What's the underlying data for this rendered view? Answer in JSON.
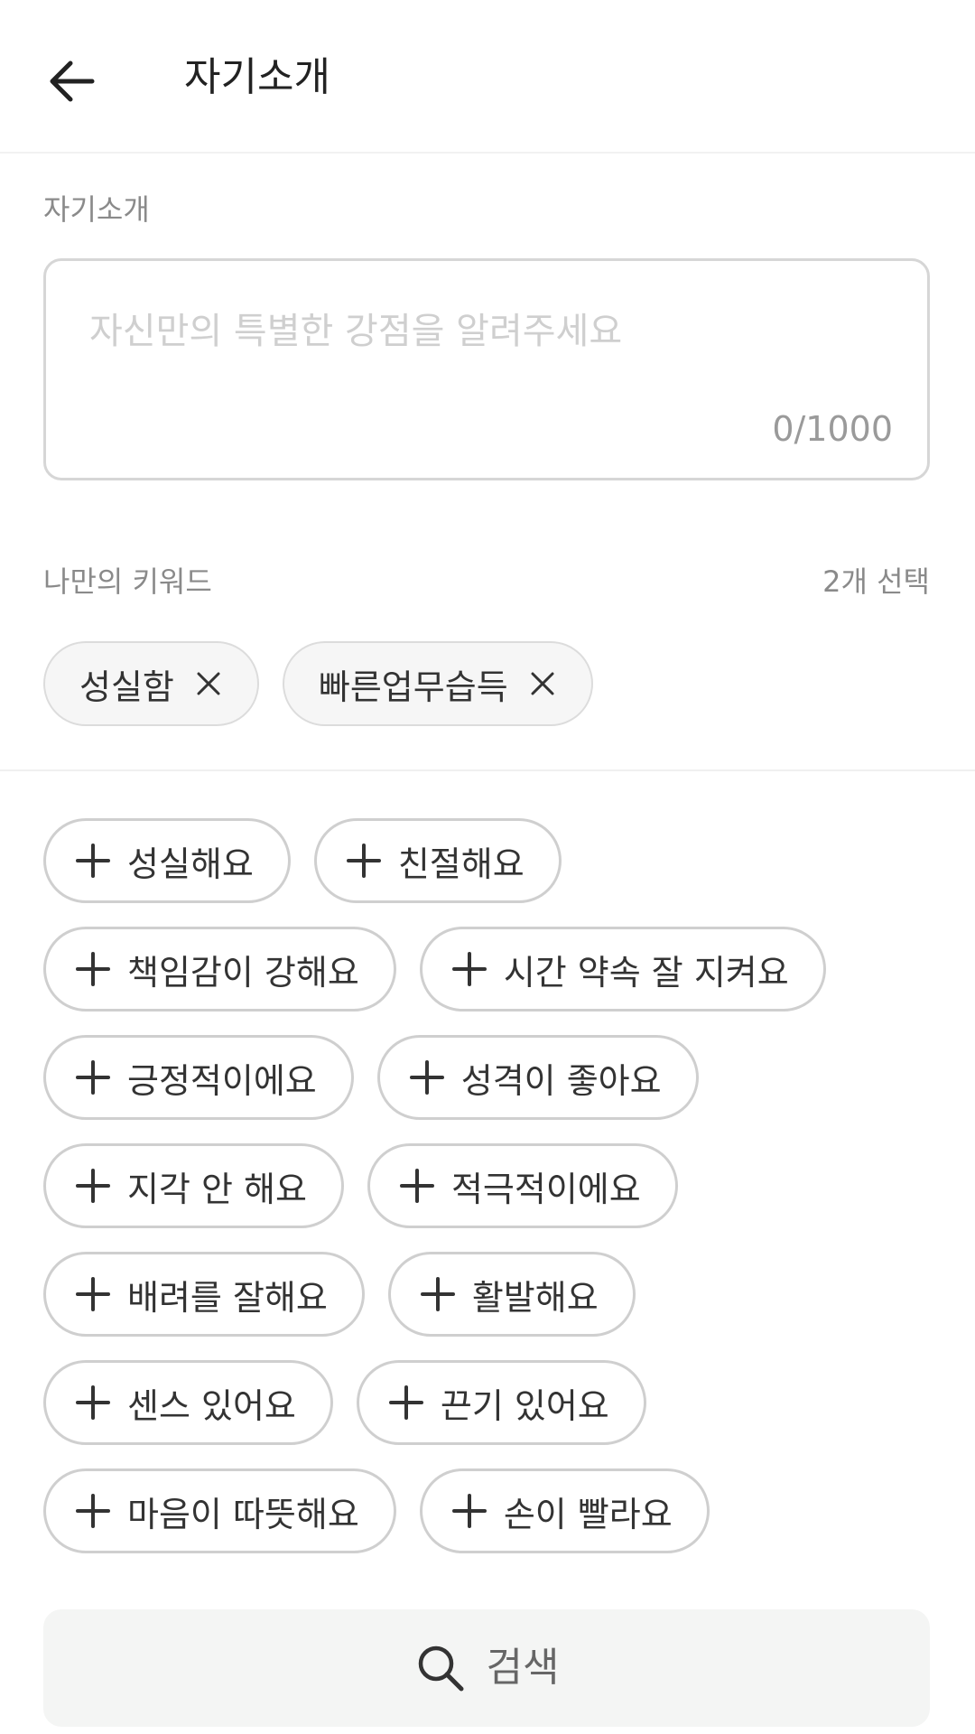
{
  "header": {
    "title": "자기소개",
    "back_icon": "arrow-left-icon"
  },
  "intro": {
    "label": "자기소개",
    "placeholder": "자신만의 특별한 강점을 알려주세요",
    "counter": "0/1000"
  },
  "keywords": {
    "label": "나만의 키워드",
    "selected_count": "2개 선택",
    "selected": [
      "성실함",
      "빠른업무습득"
    ],
    "options_rows": [
      [
        "성실해요",
        "친절해요"
      ],
      [
        "책임감이 강해요",
        "시간 약속 잘 지켜요"
      ],
      [
        "긍정적이에요",
        "성격이 좋아요"
      ],
      [
        "지각 안 해요",
        "적극적이에요"
      ],
      [
        "배려를 잘해요",
        "활발해요"
      ],
      [
        "센스 있어요",
        "끈기 있어요"
      ],
      [
        "마음이 따뜻해요",
        "손이 빨라요"
      ]
    ]
  },
  "search": {
    "label": "검색",
    "icon": "search-icon"
  },
  "colors": {
    "border": "#cfcfcf",
    "chip_selected_bg": "#f6f6f6",
    "search_bg": "#f4f5f4"
  }
}
